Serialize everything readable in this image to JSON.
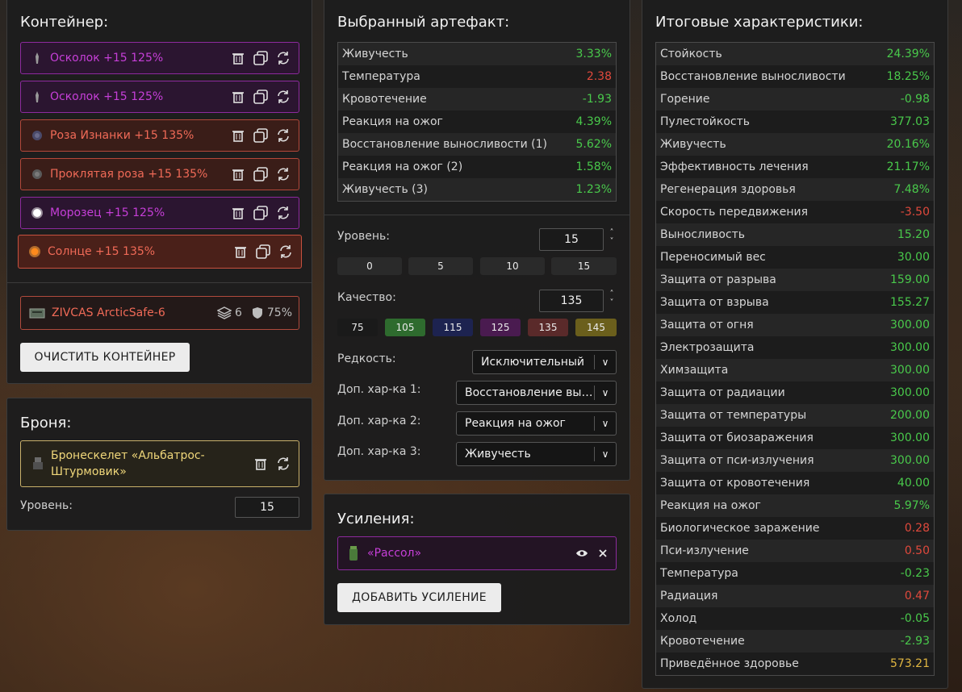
{
  "container": {
    "title": "Контейнер:",
    "items": [
      {
        "label": "Осколок +15 125%",
        "color": "purple"
      },
      {
        "label": "Осколок +15 125%",
        "color": "purple"
      },
      {
        "label": "Роза Изнанки +15 135%",
        "color": "red"
      },
      {
        "label": "Проклятая роза +15 135%",
        "color": "red"
      },
      {
        "label": "Морозец +15 125%",
        "color": "purple"
      },
      {
        "label": "Солнце +15 135%",
        "color": "red"
      }
    ],
    "case_name": "ZIVCAS ArcticSafe-6",
    "case_slots": "6",
    "case_protection": "75%",
    "clear_button": "ОЧИСТИТЬ КОНТЕЙНЕР"
  },
  "armor": {
    "title": "Броня:",
    "item_name": "Бронескелет «Альбатрос-Штурмовик»",
    "level_label": "Уровень:",
    "level_value": "15"
  },
  "artifact": {
    "title": "Выбранный артефакт:",
    "stats": [
      {
        "name": "Живучесть",
        "value": "3.33%",
        "tone": "g"
      },
      {
        "name": "Температура",
        "value": "2.38",
        "tone": "r"
      },
      {
        "name": "Кровотечение",
        "value": "-1.93",
        "tone": "g"
      },
      {
        "name": "Реакция на ожог",
        "value": "4.39%",
        "tone": "g"
      },
      {
        "name": "Восстановление выносливости (1)",
        "value": "5.62%",
        "tone": "g"
      },
      {
        "name": "Реакция на ожог (2)",
        "value": "1.58%",
        "tone": "g"
      },
      {
        "name": "Живучесть (3)",
        "value": "1.23%",
        "tone": "g"
      }
    ],
    "level_label": "Уровень:",
    "level_value": "15",
    "level_presets": [
      "0",
      "5",
      "10",
      "15"
    ],
    "quality_label": "Качество:",
    "quality_value": "135",
    "quality_presets": [
      {
        "label": "75",
        "color": "#1a1a1a"
      },
      {
        "label": "105",
        "color": "#2e6b2e"
      },
      {
        "label": "115",
        "color": "#1d2350"
      },
      {
        "label": "125",
        "color": "#4a1b50"
      },
      {
        "label": "135",
        "color": "#5a2a2a"
      },
      {
        "label": "145",
        "color": "#6b5f1c"
      }
    ],
    "rarity_label": "Редкость:",
    "rarity_value": "Исключительный",
    "extra1_label": "Доп. хар-ка 1:",
    "extra1_value": "Восстановление выносливости",
    "extra2_label": "Доп. хар-ка 2:",
    "extra2_value": "Реакция на ожог",
    "extra3_label": "Доп. хар-ка 3:",
    "extra3_value": "Живучесть"
  },
  "boosts": {
    "title": "Усиления:",
    "item_name": "«Рассол»",
    "add_button": "ДОБАВИТЬ УСИЛЕНИЕ"
  },
  "totals": {
    "title": "Итоговые характеристики:",
    "stats": [
      {
        "name": "Стойкость",
        "value": "24.39%",
        "tone": "g"
      },
      {
        "name": "Восстановление выносливости",
        "value": "18.25%",
        "tone": "g"
      },
      {
        "name": "Горение",
        "value": "-0.98",
        "tone": "g"
      },
      {
        "name": "Пулестойкость",
        "value": "377.03",
        "tone": "g"
      },
      {
        "name": "Живучесть",
        "value": "20.16%",
        "tone": "g"
      },
      {
        "name": "Эффективность лечения",
        "value": "21.17%",
        "tone": "g"
      },
      {
        "name": "Регенерация здоровья",
        "value": "7.48%",
        "tone": "g"
      },
      {
        "name": "Скорость передвижения",
        "value": "-3.50",
        "tone": "r"
      },
      {
        "name": "Выносливость",
        "value": "15.20",
        "tone": "g"
      },
      {
        "name": "Переносимый вес",
        "value": "30.00",
        "tone": "g"
      },
      {
        "name": "Защита от разрыва",
        "value": "159.00",
        "tone": "g"
      },
      {
        "name": "Защита от взрыва",
        "value": "155.27",
        "tone": "g"
      },
      {
        "name": "Защита от огня",
        "value": "300.00",
        "tone": "g"
      },
      {
        "name": "Электрозащита",
        "value": "300.00",
        "tone": "g"
      },
      {
        "name": "Химзащита",
        "value": "300.00",
        "tone": "g"
      },
      {
        "name": "Защита от радиации",
        "value": "300.00",
        "tone": "g"
      },
      {
        "name": "Защита от температуры",
        "value": "200.00",
        "tone": "g"
      },
      {
        "name": "Защита от биозаражения",
        "value": "300.00",
        "tone": "g"
      },
      {
        "name": "Защита от пси-излучения",
        "value": "300.00",
        "tone": "g"
      },
      {
        "name": "Защита от кровотечения",
        "value": "40.00",
        "tone": "g"
      },
      {
        "name": "Реакция на ожог",
        "value": "5.97%",
        "tone": "g"
      },
      {
        "name": "Биологическое заражение",
        "value": "0.28",
        "tone": "r"
      },
      {
        "name": "Пси-излучение",
        "value": "0.50",
        "tone": "r"
      },
      {
        "name": "Температура",
        "value": "-0.23",
        "tone": "g"
      },
      {
        "name": "Радиация",
        "value": "0.47",
        "tone": "r"
      },
      {
        "name": "Холод",
        "value": "-0.05",
        "tone": "g"
      },
      {
        "name": "Кровотечение",
        "value": "-2.93",
        "tone": "g"
      },
      {
        "name": "Приведённое здоровье",
        "value": "573.21",
        "tone": "y"
      }
    ]
  }
}
